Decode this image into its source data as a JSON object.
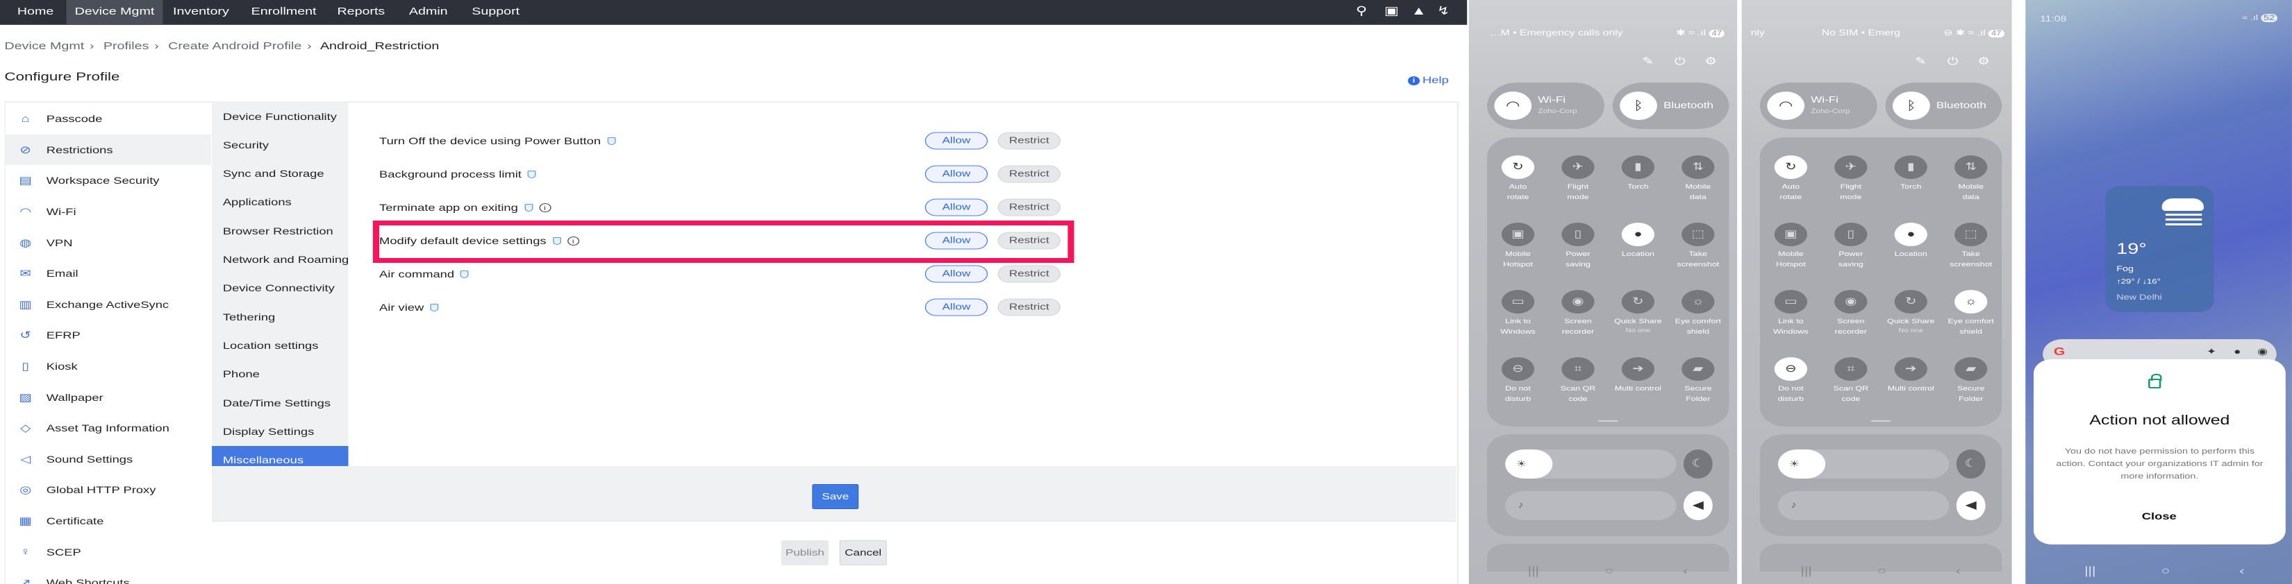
{
  "topnav": {
    "items": [
      "Home",
      "Device Mgmt",
      "Inventory",
      "Enrollment",
      "Reports",
      "Admin",
      "Support"
    ],
    "active": "Device Mgmt",
    "icons": [
      "search-icon",
      "video-icon",
      "rocket-icon",
      "bolt-icon"
    ]
  },
  "breadcrumb": [
    "Device Mgmt",
    "Profiles",
    "Create Android Profile",
    "Android_Restriction"
  ],
  "page_title": "Configure Profile",
  "help_label": "Help",
  "sidebar": {
    "selected": "Restrictions",
    "items": [
      {
        "label": "Passcode",
        "icon": "lock-icon"
      },
      {
        "label": "Restrictions",
        "icon": "ban-icon"
      },
      {
        "label": "Workspace Security",
        "icon": "document-lock-icon"
      },
      {
        "label": "Wi-Fi",
        "icon": "wifi-icon"
      },
      {
        "label": "VPN",
        "icon": "globe-lock-icon"
      },
      {
        "label": "Email",
        "icon": "email-icon"
      },
      {
        "label": "Exchange ActiveSync",
        "icon": "exchange-icon"
      },
      {
        "label": "EFRP",
        "icon": "reset-lock-icon"
      },
      {
        "label": "Kiosk",
        "icon": "kiosk-icon"
      },
      {
        "label": "Wallpaper",
        "icon": "image-icon"
      },
      {
        "label": "Asset Tag Information",
        "icon": "tag-icon"
      },
      {
        "label": "Sound Settings",
        "icon": "speaker-icon"
      },
      {
        "label": "Global HTTP Proxy",
        "icon": "globe-icon"
      },
      {
        "label": "Certificate",
        "icon": "certificate-icon"
      },
      {
        "label": "SCEP",
        "icon": "badge-icon"
      },
      {
        "label": "Web Shortcuts",
        "icon": "link-icon"
      }
    ]
  },
  "subnav": {
    "active": "Miscellaneous",
    "items": [
      "Device Functionality",
      "Security",
      "Sync and Storage",
      "Applications",
      "Browser Restriction",
      "Network and Roaming",
      "Device Connectivity",
      "Tethering",
      "Location settings",
      "Phone",
      "Date/Time Settings",
      "Display Settings",
      "Miscellaneous"
    ]
  },
  "restrictions": [
    {
      "label": "Turn Off the device using Power Button",
      "info": false,
      "allow": "Allow",
      "restrict": "Restrict",
      "selected": "Allow"
    },
    {
      "label": "Background process limit",
      "info": false,
      "allow": "Allow",
      "restrict": "Restrict",
      "selected": "Allow"
    },
    {
      "label": "Terminate app on exiting",
      "info": true,
      "allow": "Allow",
      "restrict": "Restrict",
      "selected": "Allow"
    },
    {
      "label": "Modify default device settings",
      "info": true,
      "allow": "Allow",
      "restrict": "Restrict",
      "selected": "Allow",
      "highlighted": true
    },
    {
      "label": "Air command",
      "info": false,
      "allow": "Allow",
      "restrict": "Restrict",
      "selected": "Allow"
    },
    {
      "label": "Air view",
      "info": false,
      "allow": "Allow",
      "restrict": "Restrict",
      "selected": "Allow"
    }
  ],
  "highlight_color": "#f5155a",
  "buttons": {
    "save": "Save",
    "publish": "Publish",
    "cancel": "Cancel"
  },
  "phones": [
    {
      "status_left": "…M • Emergency calls only",
      "status_center": "",
      "battery": "47",
      "wifi": {
        "label": "Wi-Fi",
        "sub": "Zoho-Corp"
      },
      "bluetooth": {
        "label": "Bluetooth"
      },
      "tiles": [
        {
          "label": [
            "Auto",
            "rotate"
          ],
          "on": true,
          "glyph": "↻"
        },
        {
          "label": [
            "Flight",
            "mode"
          ],
          "on": false,
          "glyph": "✈"
        },
        {
          "label": [
            "Torch"
          ],
          "on": false,
          "glyph": "▮"
        },
        {
          "label": [
            "Mobile",
            "data"
          ],
          "on": false,
          "glyph": "⇅"
        },
        {
          "label": [
            "Mobile",
            "Hotspot"
          ],
          "on": false,
          "glyph": "▣"
        },
        {
          "label": [
            "Power",
            "saving"
          ],
          "on": false,
          "glyph": "▯"
        },
        {
          "label": [
            "Location"
          ],
          "on": true,
          "glyph": "●"
        },
        {
          "label": [
            "Take",
            "screenshot"
          ],
          "on": false,
          "glyph": "⬚"
        },
        {
          "label": [
            "Link to",
            "Windows"
          ],
          "on": false,
          "glyph": "▭"
        },
        {
          "label": [
            "Screen",
            "recorder"
          ],
          "on": false,
          "glyph": "◉"
        },
        {
          "label": [
            "Quick Share"
          ],
          "sub": "No one",
          "on": false,
          "glyph": "↻"
        },
        {
          "label": [
            "Eye comfort",
            "shield"
          ],
          "on": false,
          "glyph": "☼"
        },
        {
          "label": [
            "Do not",
            "disturb"
          ],
          "on": false,
          "glyph": "⊖"
        },
        {
          "label": [
            "Scan QR",
            "code"
          ],
          "on": false,
          "glyph": "⌗"
        },
        {
          "label": [
            "Multi control"
          ],
          "on": false,
          "glyph": "➔"
        },
        {
          "label": [
            "Secure",
            "Folder"
          ],
          "on": false,
          "glyph": "▰"
        }
      ]
    },
    {
      "status_left": "nly",
      "status_center": "No SIM • Emerg",
      "battery": "47",
      "wifi": {
        "label": "Wi-Fi",
        "sub": "Zoho-Corp"
      },
      "bluetooth": {
        "label": "Bluetooth"
      },
      "tiles": [
        {
          "label": [
            "Auto",
            "rotate"
          ],
          "on": true,
          "glyph": "↻"
        },
        {
          "label": [
            "Flight",
            "mode"
          ],
          "on": false,
          "glyph": "✈"
        },
        {
          "label": [
            "Torch"
          ],
          "on": false,
          "glyph": "▮"
        },
        {
          "label": [
            "Mobile",
            "data"
          ],
          "on": false,
          "glyph": "⇅"
        },
        {
          "label": [
            "Mobile",
            "Hotspot"
          ],
          "on": false,
          "glyph": "▣"
        },
        {
          "label": [
            "Power",
            "saving"
          ],
          "on": false,
          "glyph": "▯"
        },
        {
          "label": [
            "Location"
          ],
          "on": true,
          "glyph": "●"
        },
        {
          "label": [
            "Take",
            "screenshot"
          ],
          "on": false,
          "glyph": "⬚"
        },
        {
          "label": [
            "Link to",
            "Windows"
          ],
          "on": false,
          "glyph": "▭"
        },
        {
          "label": [
            "Screen",
            "recorder"
          ],
          "on": false,
          "glyph": "◉"
        },
        {
          "label": [
            "Quick Share"
          ],
          "sub": "No one",
          "on": false,
          "glyph": "↻"
        },
        {
          "label": [
            "Eye comfort",
            "shield"
          ],
          "on": true,
          "glyph": "☼"
        },
        {
          "label": [
            "Do not",
            "disturb"
          ],
          "on": true,
          "glyph": "⊖"
        },
        {
          "label": [
            "Scan QR",
            "code"
          ],
          "on": false,
          "glyph": "⌗"
        },
        {
          "label": [
            "Multi control"
          ],
          "on": false,
          "glyph": "➔"
        },
        {
          "label": [
            "Secure",
            "Folder"
          ],
          "on": false,
          "glyph": "▰"
        }
      ]
    }
  ],
  "lockscreen": {
    "time": "11:08",
    "battery": "52",
    "weather": {
      "temp": "19°",
      "condition": "Fog",
      "range": "↑29° / ↓16°",
      "city": "New Delhi"
    },
    "dialog": {
      "title": "Action not allowed",
      "body": "You do not have permission to perform this action. Contact your organizations IT admin for more information.",
      "close": "Close"
    }
  }
}
